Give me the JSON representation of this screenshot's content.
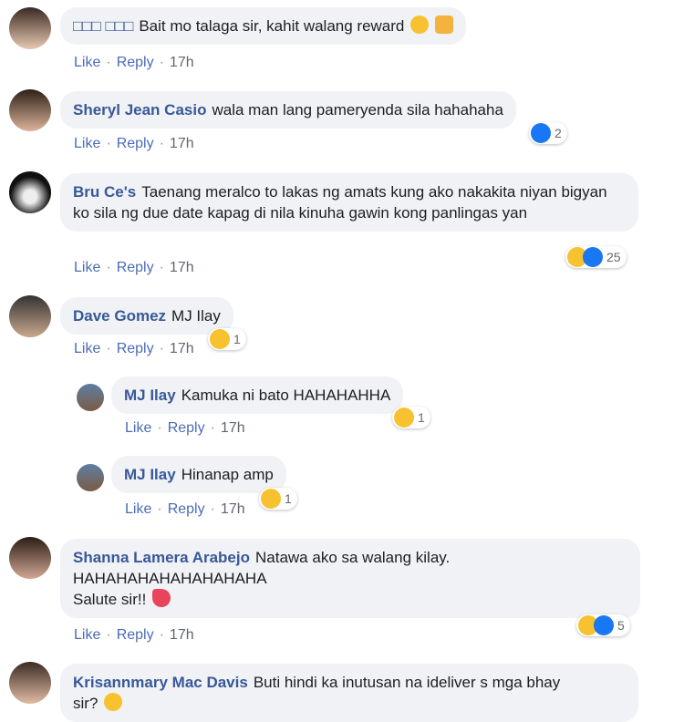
{
  "comments": [
    {
      "author": "□□□ □□□",
      "text": "Bait mo talaga sir, kahit walang reward",
      "like": "Like",
      "reply": "Reply",
      "time": "17h"
    },
    {
      "author": "Sheryl Jean Casio",
      "text": "wala man lang pameryenda sila hahahaha",
      "like": "Like",
      "reply": "Reply",
      "time": "17h",
      "reactions": "2"
    },
    {
      "author": "Bru Ce's",
      "text": "Taenang meralco to lakas ng amats kung ako nakakita niyan bigyan ko sila ng due date kapag di nila kinuha gawin kong panlingas yan",
      "like": "Like",
      "reply": "Reply",
      "time": "17h",
      "reactions": "25"
    },
    {
      "author": "Dave Gomez",
      "text": "MJ Ilay",
      "like": "Like",
      "reply": "Reply",
      "time": "17h",
      "reactions": "1"
    },
    {
      "author": "MJ Ilay",
      "text": "Kamuka ni bato HAHAHAHHA",
      "like": "Like",
      "reply": "Reply",
      "time": "17h",
      "reactions": "1"
    },
    {
      "author": "MJ Ilay",
      "text": "Hinanap amp",
      "like": "Like",
      "reply": "Reply",
      "time": "17h",
      "reactions": "1"
    },
    {
      "author": "Shanna Lamera Arabejo",
      "text": "Natawa ako sa walang kilay.",
      "text2": "HAHAHAHAHAHAHAHAHA",
      "text3": "Salute sir!!",
      "like": "Like",
      "reply": "Reply",
      "time": "17h",
      "reactions": "5"
    },
    {
      "author": "Krisannmary Mac Davis",
      "text": "Buti hindi ka inutusan na ideliver s mga bhay",
      "text2": "sir?"
    }
  ]
}
